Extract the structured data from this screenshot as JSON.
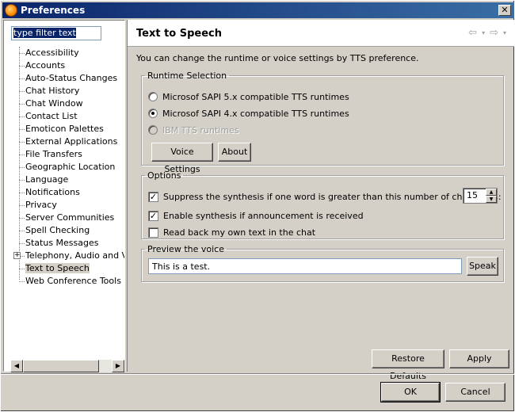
{
  "window": {
    "title": "Preferences",
    "close_label": "✕"
  },
  "sidebar": {
    "filter_placeholder": "type filter text",
    "items": [
      {
        "label": "Accessibility"
      },
      {
        "label": "Accounts"
      },
      {
        "label": "Auto-Status Changes"
      },
      {
        "label": "Chat History"
      },
      {
        "label": "Chat Window"
      },
      {
        "label": "Contact List"
      },
      {
        "label": "Emoticon Palettes"
      },
      {
        "label": "External Applications"
      },
      {
        "label": "File Transfers"
      },
      {
        "label": "Geographic Location"
      },
      {
        "label": "Language"
      },
      {
        "label": "Notifications"
      },
      {
        "label": "Privacy"
      },
      {
        "label": "Server Communities"
      },
      {
        "label": "Spell Checking"
      },
      {
        "label": "Status Messages"
      },
      {
        "label": "Telephony, Audio and Vid",
        "expandable": true,
        "expander": "+"
      },
      {
        "label": "Text to Speech",
        "selected": true
      },
      {
        "label": "Web Conference Tools"
      }
    ],
    "scroll_left": "◀",
    "scroll_right": "▶"
  },
  "page": {
    "title": "Text to Speech",
    "nav_back": "⇦",
    "nav_forward": "⇨",
    "nav_menu": "▾",
    "description": "You can change the runtime or voice settings by TTS preference.",
    "runtime": {
      "title": "Runtime Selection",
      "options": [
        {
          "label": "Microsof SAPI 5.x compatible TTS runtimes",
          "checked": false,
          "disabled": false
        },
        {
          "label": "Microsof SAPI 4.x compatible TTS runtimes",
          "checked": true,
          "disabled": false
        },
        {
          "label": "IBM TTS runtimes",
          "checked": false,
          "disabled": true
        }
      ],
      "voice_settings_label": "Voice Settings",
      "about_label": "About"
    },
    "options": {
      "title": "Options",
      "suppress_label": "Suppress the synthesis if one word is greater than this number of characters:",
      "suppress_checked": true,
      "max_chars": "15",
      "announcement_label": "Enable synthesis if announcement is received",
      "announcement_checked": true,
      "readback_label": "Read back my own text in the chat",
      "readback_checked": false,
      "check_mark": "✓"
    },
    "preview": {
      "title": "Preview the voice",
      "text": "This is a test.",
      "speak_label": "Speak"
    },
    "restore_defaults_label": "Restore Defaults",
    "apply_label": "Apply"
  },
  "footer": {
    "ok_label": "OK",
    "cancel_label": "Cancel"
  }
}
